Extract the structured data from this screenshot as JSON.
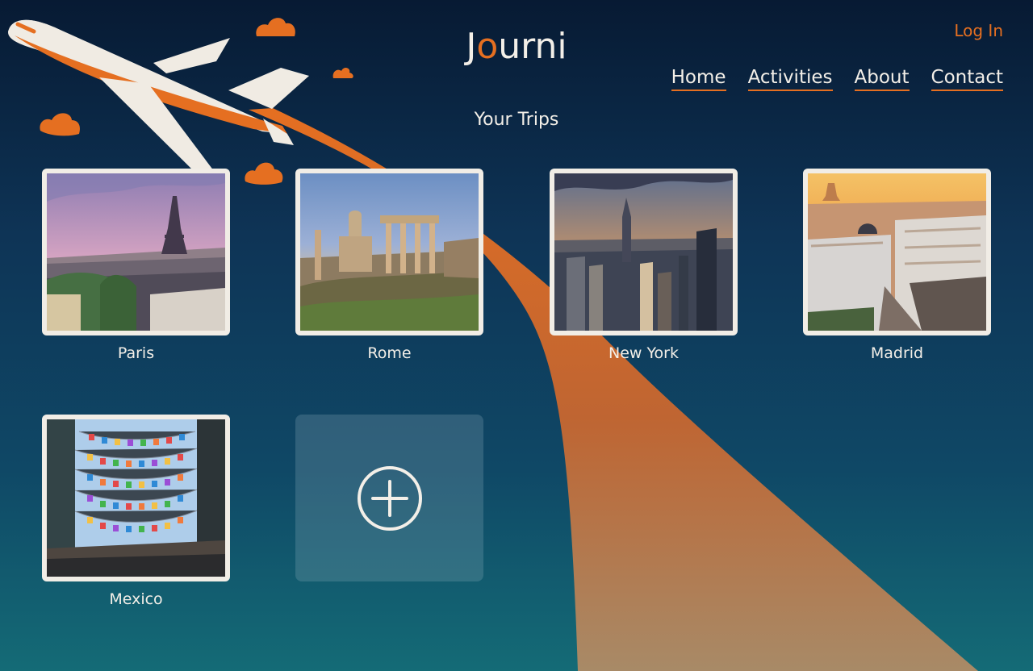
{
  "brand": {
    "logo_text": "Journi",
    "logo_parts": {
      "first": "J",
      "accent": "o",
      "middle": "urn",
      "last": "i"
    }
  },
  "header": {
    "login_label": "Log In"
  },
  "navigation": {
    "items": [
      {
        "label": "Home"
      },
      {
        "label": "Activities"
      },
      {
        "label": "About"
      },
      {
        "label": "Contact"
      }
    ]
  },
  "trips": {
    "title": "Your Trips",
    "cards": [
      {
        "label": "Paris"
      },
      {
        "label": "Rome"
      },
      {
        "label": "New York"
      },
      {
        "label": "Madrid"
      },
      {
        "label": "Mexico"
      }
    ]
  },
  "theme": {
    "accent": "#e56f21",
    "text": "#f3efe8",
    "background_top": "#071a33",
    "background_bottom": "#146b76"
  },
  "icons": {
    "add_trip": "plus-circle-icon",
    "decorative_plane": "airplane-icon",
    "decorative_clouds": "cloud-icon"
  }
}
